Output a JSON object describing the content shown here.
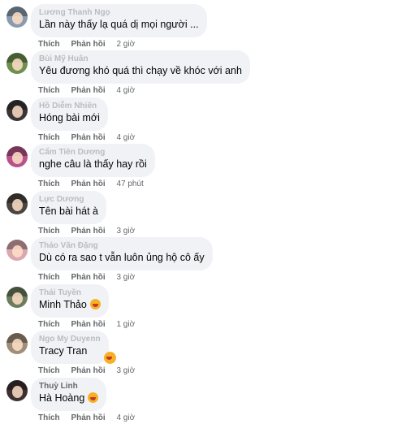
{
  "comments": [
    {
      "author": "Lương Thanh Ngọ",
      "text": "Lần này thấy lạ quá dị mọi người ...",
      "like": "Thích",
      "reply": "Phản hồi",
      "time": "2 giờ",
      "avatar_color": "#8a9bb0"
    },
    {
      "author": "Bùi Mỹ Huân",
      "text": "Yêu đương khó quá thì chạy về khóc với anh",
      "like": "Thích",
      "reply": "Phản hồi",
      "time": "4 giờ",
      "avatar_color": "#6e8f4e"
    },
    {
      "author": "Hồ Diễm Nhiên",
      "text": "Hóng bài mới",
      "like": "Thích",
      "reply": "Phản hồi",
      "time": "4 giờ",
      "avatar_color": "#3b3538"
    },
    {
      "author": "Cẩm Tiên Dương",
      "text": "nghe câu là thấy hay rồi",
      "like": "Thích",
      "reply": "Phản hồi",
      "time": "47 phút",
      "avatar_color": "#b8528a"
    },
    {
      "author": "Lực Dương",
      "text": "Tên bài hát à",
      "like": "Thích",
      "reply": "Phản hồi",
      "time": "3 giờ",
      "avatar_color": "#4a4540"
    },
    {
      "author": "Thảo Văn Đặng",
      "text": "Dù có ra sao t vẫn luôn ủng hộ cô ấy",
      "like": "Thích",
      "reply": "Phản hồi",
      "time": "3 giờ",
      "avatar_color": "#d9a8b0"
    },
    {
      "author": "Thái Tuyền",
      "text": "Minh Thảo",
      "like": "Thích",
      "reply": "Phản hồi",
      "time": "1 giờ",
      "avatar_color": "#6b7d5c",
      "emoji": "laughing-emoji"
    },
    {
      "author": "Ngo My Duyenn",
      "text": "Tracy Tran",
      "like": "Thích",
      "reply": "Phản hồi",
      "time": "3 giờ",
      "avatar_color": "#a08e7a",
      "emoji": "laughing-emoji"
    },
    {
      "author": "Thuỳ Linh",
      "text": "Hà Hoàng",
      "like": "Thích",
      "reply": "Phản hồi",
      "time": "4 giờ",
      "avatar_color": "#3d3030",
      "emoji": "laughing-emoji"
    }
  ]
}
